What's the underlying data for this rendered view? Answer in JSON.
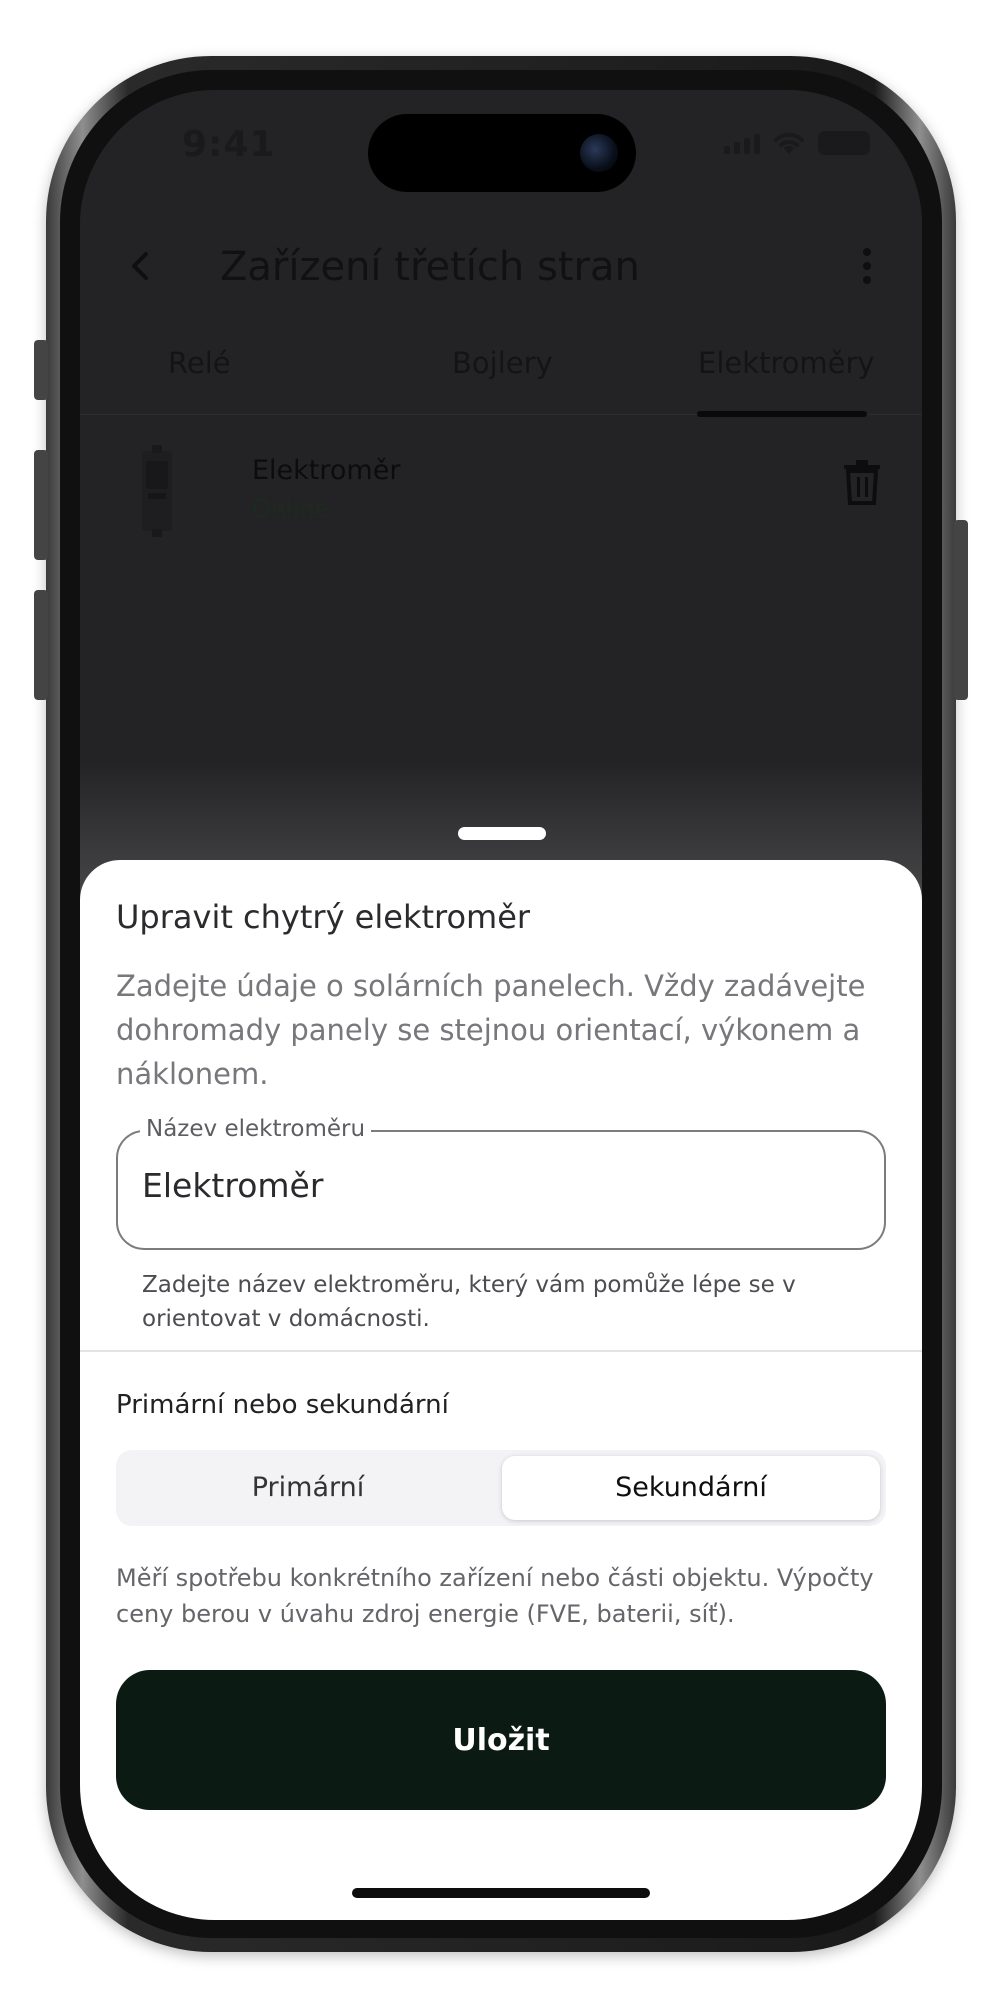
{
  "status_bar": {
    "time": "9:41"
  },
  "app_bar": {
    "title": "Zařízení třetích stran"
  },
  "tabs": [
    {
      "label": "Relé"
    },
    {
      "label": "Bojlery"
    },
    {
      "label": "Elektroměry"
    }
  ],
  "device": {
    "name": "Elektroměr",
    "status": "Online"
  },
  "sheet": {
    "title": "Upravit chytrý elektroměr",
    "description": "Zadejte údaje o solárních panelech. Vždy zadávejte dohromady panely se stejnou orientací, výkonem a náklonem.",
    "name_field": {
      "label": "Název elektroměru",
      "value": "Elektroměr",
      "helper": "Zadejte název elektroměru, který vám pomůže lépe se v orientovat v domácnosti."
    },
    "type_section": {
      "label": "Primární nebo sekundární",
      "options": [
        "Primární",
        "Sekundární"
      ],
      "selected": "Sekundární",
      "helper": "Měří spotřebu konkrétního zařízení nebo části objektu. Výpočty ceny berou v úvahu zdroj energie (FVE, baterii, síť)."
    },
    "save_label": "Uložit"
  },
  "colors": {
    "overlay_background": "#232325",
    "primary_button": "#0c1a14",
    "sheet_background": "#ffffff"
  }
}
